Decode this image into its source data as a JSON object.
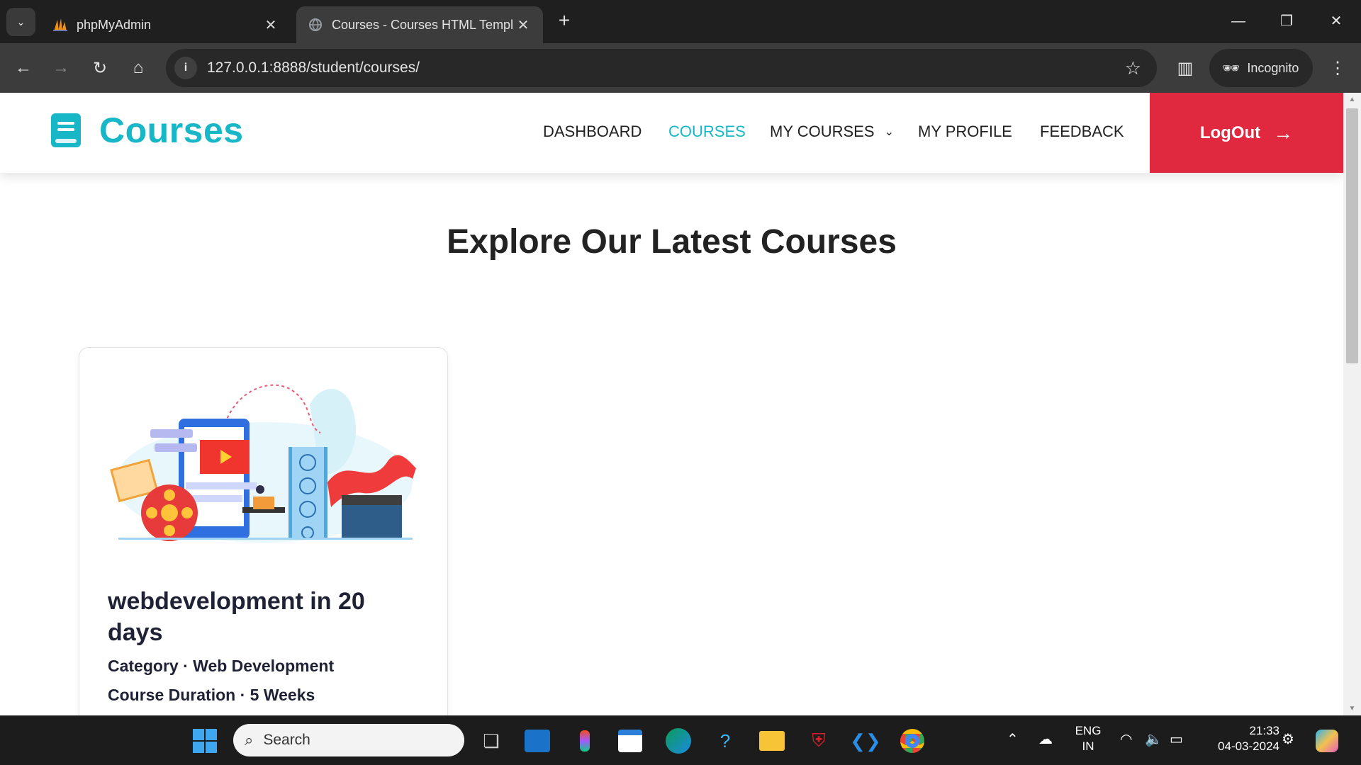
{
  "browser": {
    "tabs": [
      {
        "title": "phpMyAdmin",
        "active": false
      },
      {
        "title": "Courses - Courses HTML Templ",
        "active": true
      }
    ],
    "url": "127.0.0.1:8888/student/courses/",
    "incognito_label": "Incognito"
  },
  "site": {
    "brand": "Courses",
    "nav": [
      {
        "label": "DASHBOARD",
        "active": false
      },
      {
        "label": "COURSES",
        "active": true
      },
      {
        "label": "MY COURSES",
        "active": false,
        "dropdown": true
      },
      {
        "label": "MY PROFILE",
        "active": false
      },
      {
        "label": "FEEDBACK",
        "active": false
      }
    ],
    "logout_label": "LogOut",
    "accent_color": "#17b7c7",
    "logout_color": "#e0293f"
  },
  "main": {
    "heading": "Explore Our Latest Courses",
    "courses": [
      {
        "title": "webdevelopment in 20 days",
        "category_label": "Category",
        "category": "Web Development",
        "duration_label": "Course Duration",
        "duration": "5 Weeks"
      }
    ]
  },
  "taskbar": {
    "search_placeholder": "Search",
    "language": "ENG",
    "region": "IN",
    "time": "21:33",
    "date": "04-03-2024"
  }
}
